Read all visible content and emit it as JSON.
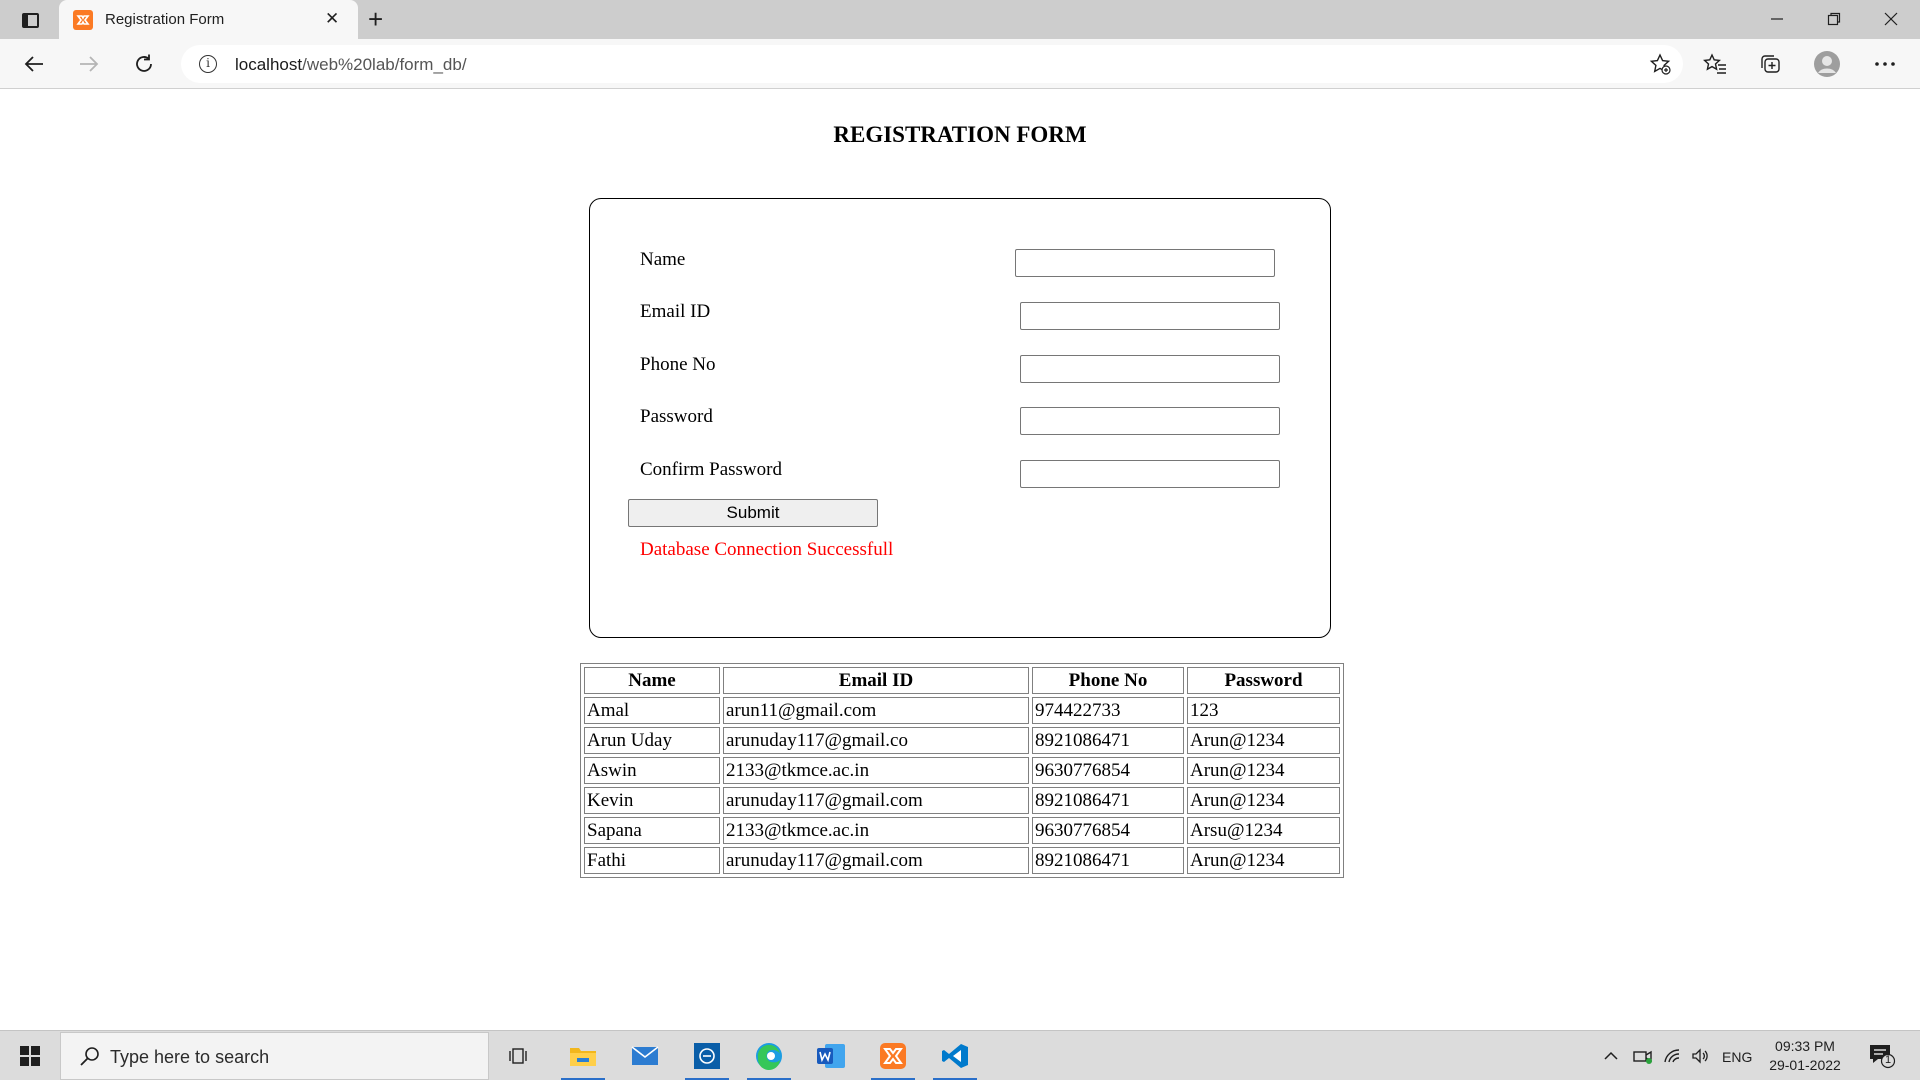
{
  "browser": {
    "tab_title": "Registration Form",
    "tab_close": "✕",
    "new_tab": "+",
    "url_host": "localhost",
    "url_path": "/web%20lab/form_db/",
    "icons": [
      "tab-actions-icon",
      "xampp-favicon",
      "back-icon",
      "forward-icon",
      "refresh-icon",
      "info-icon",
      "add-favorite-icon",
      "favorites-icon",
      "collections-icon",
      "profile-icon",
      "more-icon",
      "minimize-icon",
      "restore-icon",
      "close-icon"
    ]
  },
  "page": {
    "title": "REGISTRATION FORM",
    "fields": [
      {
        "label": "Name",
        "value": ""
      },
      {
        "label": "Email ID",
        "value": ""
      },
      {
        "label": "Phone No",
        "value": ""
      },
      {
        "label": "Password",
        "value": ""
      },
      {
        "label": "Confirm Password",
        "value": ""
      }
    ],
    "submit_label": "Submit",
    "status_message": "Database Connection Successfull",
    "status_color": "#ff0000"
  },
  "table": {
    "headers": [
      "Name",
      "Email ID",
      "Phone No",
      "Password"
    ],
    "rows": [
      [
        "Amal",
        "arun11@gmail.com",
        "974422733",
        "123"
      ],
      [
        "Arun Uday",
        "arunuday117@gmail.co",
        "8921086471",
        "Arun@1234"
      ],
      [
        "Aswin",
        "2133@tkmce.ac.in",
        "9630776854",
        "Arun@1234"
      ],
      [
        "Kevin",
        "arunuday117@gmail.com",
        "8921086471",
        "Arun@1234"
      ],
      [
        "Sapana",
        "2133@tkmce.ac.in",
        "9630776854",
        "Arsu@1234"
      ],
      [
        "Fathi",
        "arunuday117@gmail.com",
        "8921086471",
        "Arun@1234"
      ]
    ]
  },
  "taskbar": {
    "search_placeholder": "Type here to search",
    "apps": [
      "task-view",
      "file-explorer",
      "mail",
      "dell-app",
      "edge",
      "word",
      "xampp",
      "vscode"
    ],
    "active_apps": [
      "file-explorer",
      "dell-app",
      "edge",
      "xampp",
      "vscode"
    ],
    "tray_lang": "ENG",
    "time": "09:33 PM",
    "date": "29-01-2022",
    "notification_count": "1"
  }
}
